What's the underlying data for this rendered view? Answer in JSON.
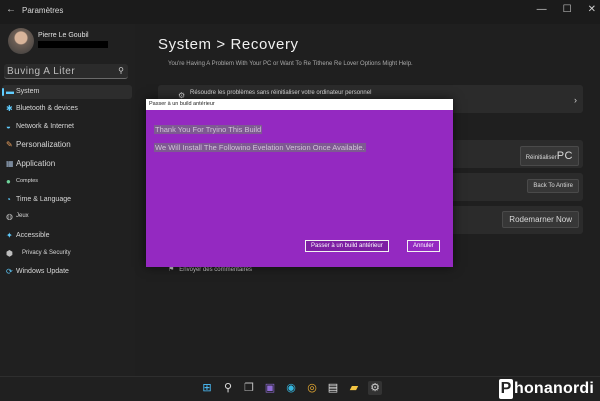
{
  "window": {
    "title": "Paramètres"
  },
  "user": {
    "name": "Pierre Le Goubil"
  },
  "search": {
    "value": "Buving A Liter"
  },
  "sidebar": {
    "items": [
      {
        "label": "System",
        "selected": true
      },
      {
        "label": "Bluetooth & devices"
      },
      {
        "label": "Network & Internet"
      },
      {
        "label": "Personalization"
      },
      {
        "label": "Application"
      },
      {
        "label": "Comptes"
      },
      {
        "label": "Time & Language"
      },
      {
        "label": "Jeux"
      },
      {
        "label": "Accessible"
      },
      {
        "label": "Privacy & Security"
      },
      {
        "label": "Windows Update"
      }
    ]
  },
  "main": {
    "title": "System > Recovery",
    "subtitle": "You're Having A Problem With Your PC or Want To Re Tithene Re Lover Options Might Help.",
    "card1_text": "Résoudre les problèmes sans réinitialiser votre ordinateur personnel",
    "button_reset_prefix": "Réinitialiser",
    "button_reset_suffix": "PC",
    "button_back": "Back To Antiire",
    "button_restart": "Rodemarner Now",
    "feedback": "Envoyer des commentaires"
  },
  "dialog": {
    "title": "Passer à un build antérieur",
    "line1": "Thank You For Tryino This Build",
    "line2": "We Will Install The Followino Evelation Version Once Available.",
    "primary_button": "Passer à un build antérieur",
    "cancel_button": "Annuler"
  },
  "watermark": {
    "box": "P",
    "text": "honanordi"
  },
  "colors": {
    "dialog": "#9429c1",
    "accent": "#60cdff"
  }
}
